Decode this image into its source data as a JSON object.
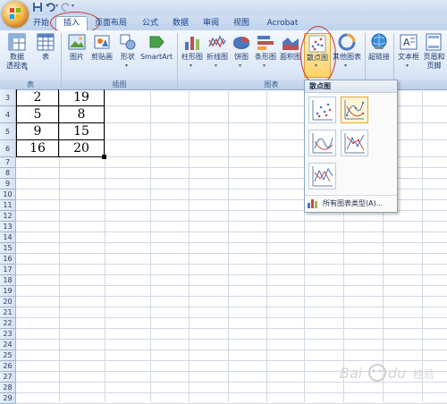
{
  "tabs": [
    {
      "label": "开始"
    },
    {
      "label": "插入"
    },
    {
      "label": "页面布局"
    },
    {
      "label": "公式"
    },
    {
      "label": "数据"
    },
    {
      "label": "审阅"
    },
    {
      "label": "视图"
    },
    {
      "label": "Acrobat"
    }
  ],
  "groups": {
    "table": "表",
    "illustrations": "插图",
    "charts": "图表"
  },
  "buttons": {
    "pivot": "数据\n透视表",
    "table": "表",
    "picture": "图片",
    "clipart": "剪贴画",
    "shapes": "形状",
    "smartart": "SmartArt",
    "bar": "柱形图",
    "line": "折线图",
    "pie": "饼图",
    "hbar": "条形图",
    "area": "面积图",
    "scatter": "散点图",
    "other": "其他图表",
    "hyperlink": "超链接",
    "textbox": "文本框",
    "header": "页眉和\n页脚"
  },
  "dropdown": {
    "title": "散点图",
    "all_types": "所有图表类型(A)..."
  },
  "rows": [
    "3",
    "4",
    "5",
    "6",
    "7",
    "8",
    "9",
    "10",
    "11",
    "12",
    "13",
    "14",
    "15",
    "16",
    "17",
    "18",
    "19",
    "20",
    "21",
    "22",
    "23",
    "24",
    "25",
    "26",
    "27",
    "28",
    "29"
  ],
  "table": [
    [
      "2",
      "19"
    ],
    [
      "5",
      "8"
    ],
    [
      "9",
      "15"
    ],
    [
      "16",
      "20"
    ]
  ],
  "watermark": "Bai du 经验"
}
